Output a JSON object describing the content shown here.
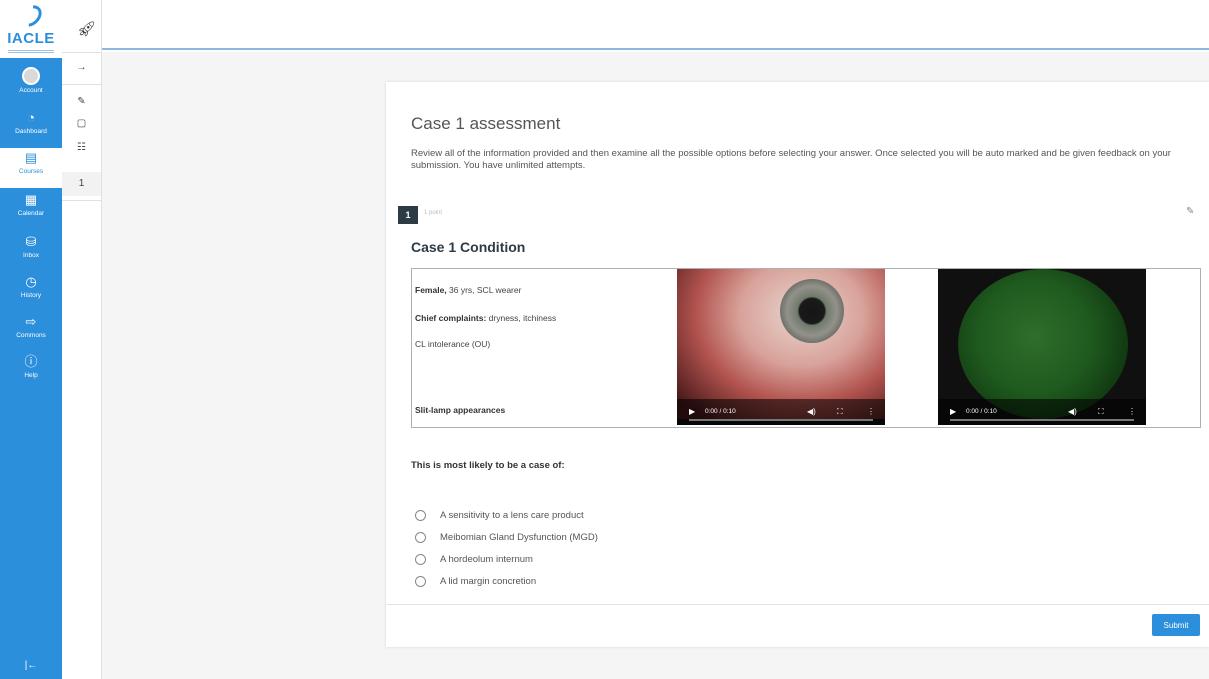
{
  "logo": {
    "text": "IACLE"
  },
  "global_nav": {
    "items": [
      {
        "label": "Account",
        "icon": "account-avatar-icon"
      },
      {
        "label": "Dashboard",
        "icon": "dashboard-icon"
      },
      {
        "label": "Courses",
        "icon": "courses-icon",
        "active": true
      },
      {
        "label": "Calendar",
        "icon": "calendar-icon"
      },
      {
        "label": "Inbox",
        "icon": "inbox-icon"
      },
      {
        "label": "History",
        "icon": "history-icon"
      },
      {
        "label": "Commons",
        "icon": "commons-icon"
      },
      {
        "label": "Help",
        "icon": "help-icon"
      }
    ],
    "collapse_icon": "|←"
  },
  "course_strip": {
    "items": [
      "→",
      "✎",
      "▢",
      "☷",
      "1"
    ]
  },
  "topbar": {
    "rocket_icon": "rocket-icon"
  },
  "quiz": {
    "title": "Case 1 assessment",
    "intro": "Review all of the information provided and then examine all the possible options before selecting your answer. Once selected you will be auto marked and be given feedback on your submission. You have unlimited attempts.",
    "question_number": "1",
    "points": "1 point",
    "condition_title": "Case 1 Condition",
    "case": {
      "patient_label": "Female,",
      "patient_detail": " 36 yrs, SCL wearer",
      "complaints_label": "Chief complaints:",
      "complaints_detail": " dryness, itchiness",
      "history": "CL intolerance (OU)",
      "slit_lamp_label": "Slit-lamp appearances"
    },
    "videos": [
      {
        "time": "0:00 / 0:10",
        "progress": 0.0
      },
      {
        "time": "0:00 / 0:10",
        "progress": 0.0
      }
    ],
    "prompt": "This is most likely to be a case of:",
    "answers": [
      "A sensitivity to a lens care product",
      "Meibomian Gland Dysfunction (MGD)",
      "A hordeolum internum",
      "A lid margin concretion"
    ],
    "submit_label": "Submit"
  },
  "colors": {
    "brand": "#2b8fdc",
    "question_badge": "#2d3b45"
  }
}
